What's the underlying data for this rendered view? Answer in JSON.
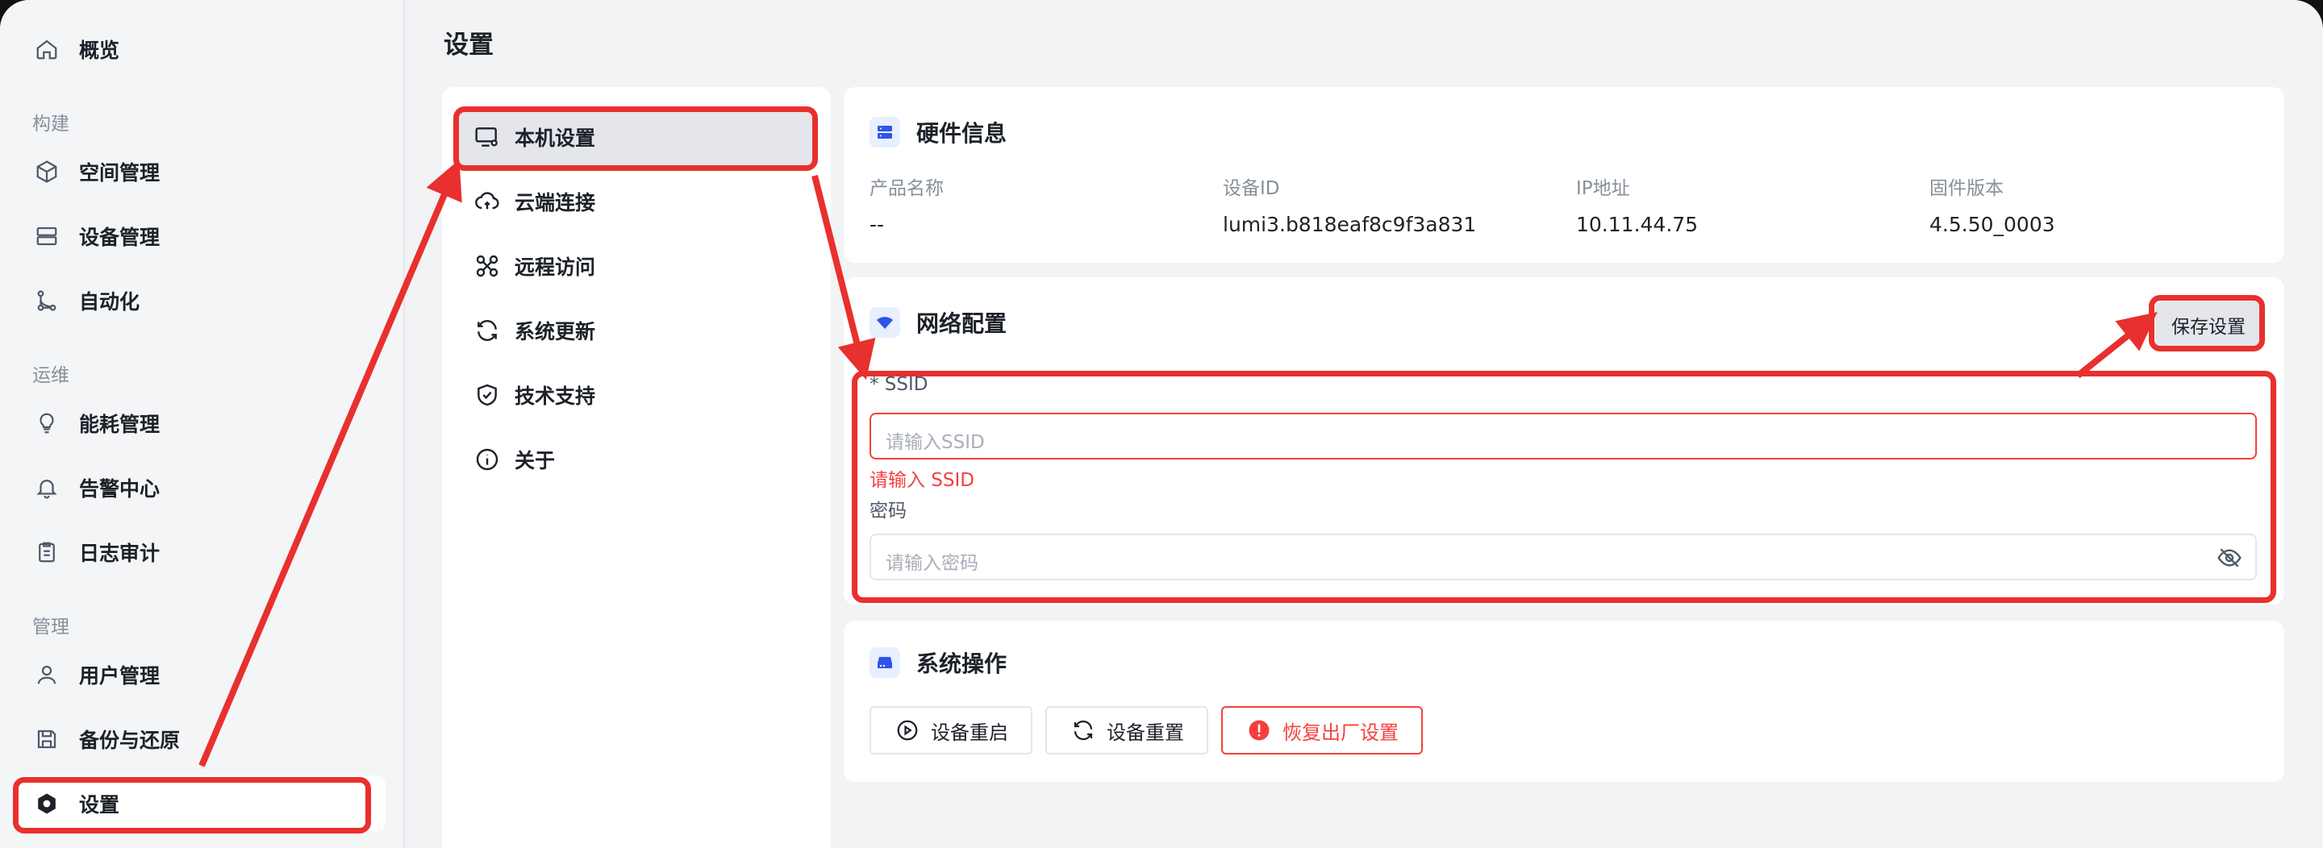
{
  "page_title": "设置",
  "sidebar": {
    "items": [
      {
        "label": "概览",
        "icon": "home-icon"
      },
      {
        "group": "构建"
      },
      {
        "label": "空间管理",
        "icon": "cube-icon"
      },
      {
        "label": "设备管理",
        "icon": "server-icon"
      },
      {
        "label": "自动化",
        "icon": "workflow-icon"
      },
      {
        "group": "运维"
      },
      {
        "label": "能耗管理",
        "icon": "bulb-icon"
      },
      {
        "label": "告警中心",
        "icon": "bell-icon"
      },
      {
        "label": "日志审计",
        "icon": "clipboard-icon"
      },
      {
        "group": "管理"
      },
      {
        "label": "用户管理",
        "icon": "user-icon"
      },
      {
        "label": "备份与还原",
        "icon": "save-icon"
      },
      {
        "label": "设置",
        "icon": "settings-icon",
        "active": true
      }
    ]
  },
  "settings_menu": {
    "items": [
      {
        "label": "本机设置",
        "icon": "monitor-gear-icon",
        "active": true
      },
      {
        "label": "云端连接",
        "icon": "cloud-sync-icon"
      },
      {
        "label": "远程访问",
        "icon": "remote-icon"
      },
      {
        "label": "系统更新",
        "icon": "refresh-icon"
      },
      {
        "label": "技术支持",
        "icon": "shield-check-icon"
      },
      {
        "label": "关于",
        "icon": "info-icon"
      }
    ]
  },
  "hardware": {
    "title": "硬件信息",
    "fields": [
      {
        "key": "产品名称",
        "value": "--"
      },
      {
        "key": "设备ID",
        "value": "lumi3.b818eaf8c9f3a831"
      },
      {
        "key": "IP地址",
        "value": "10.11.44.75"
      },
      {
        "key": "固件版本",
        "value": "4.5.50_0003"
      }
    ]
  },
  "network": {
    "title": "网络配置",
    "save_label": "保存设置",
    "ssid_label": "* SSID",
    "ssid_placeholder": "请输入SSID",
    "ssid_error": "请输入 SSID",
    "password_label": "密码",
    "password_placeholder": "请输入密码"
  },
  "system_ops": {
    "title": "系统操作",
    "buttons": [
      {
        "label": "设备重启",
        "icon": "play-circle-icon"
      },
      {
        "label": "设备重置",
        "icon": "refresh-icon"
      },
      {
        "label": "恢复出厂设置",
        "icon": "alert-circle-icon",
        "danger": true
      }
    ]
  },
  "colors": {
    "accent": "#2f54eb",
    "danger": "#f53f3f",
    "annotation": "#e8302e"
  }
}
